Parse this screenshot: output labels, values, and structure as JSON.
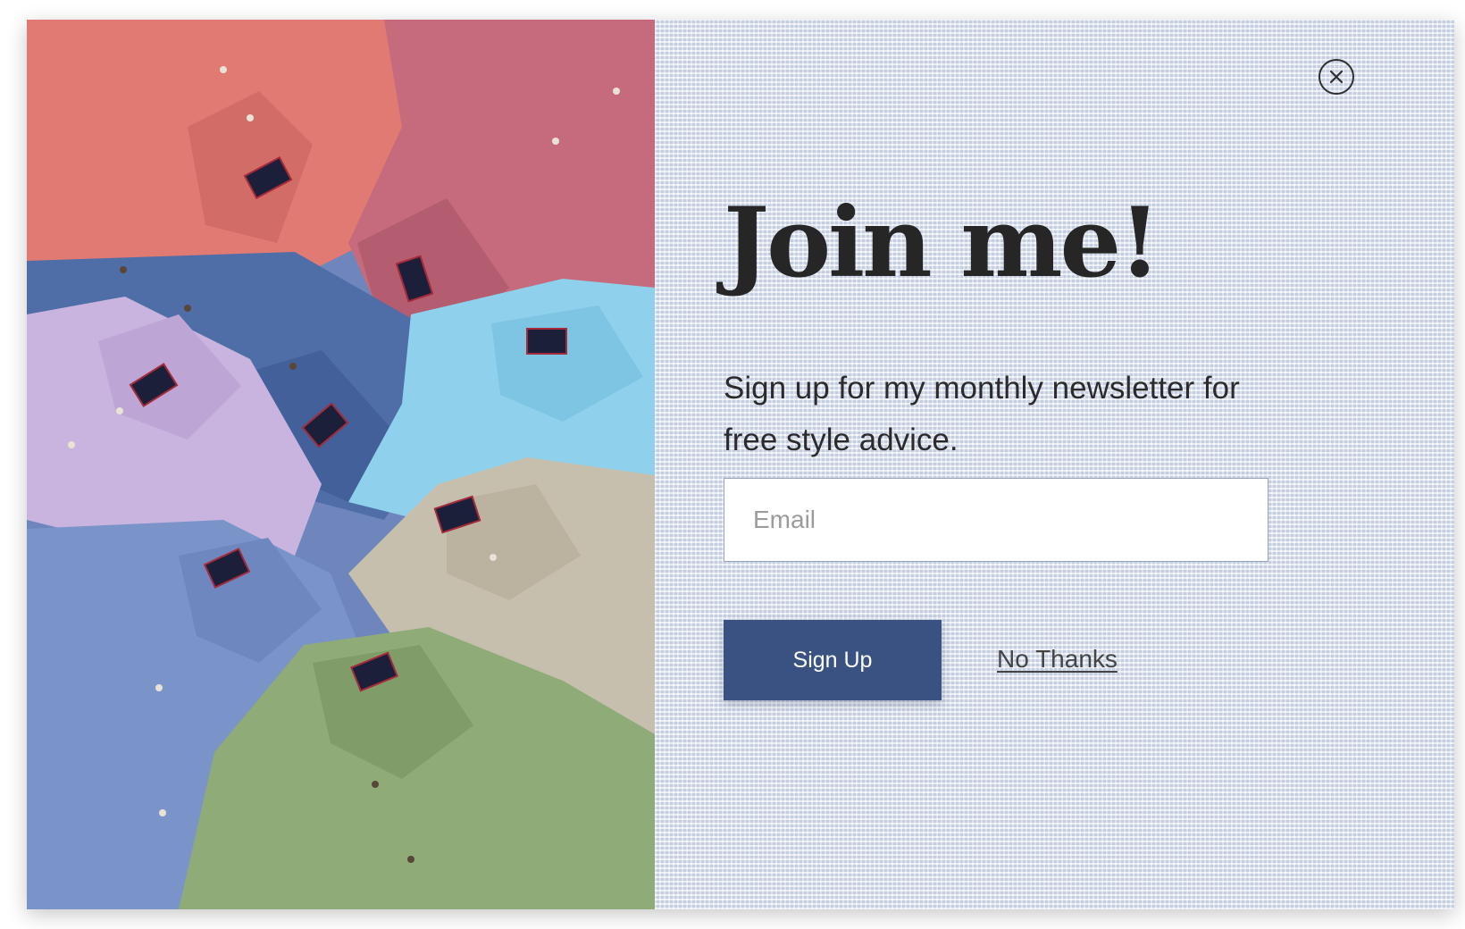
{
  "popup": {
    "headline": "Join me!",
    "subtext": "Sign up for my monthly newsletter for free style advice.",
    "email": {
      "placeholder": "Email",
      "value": ""
    },
    "signup_label": "Sign Up",
    "no_thanks_label": "No Thanks",
    "close_icon": "close-icon",
    "image_description_icon": "shirts-photo"
  },
  "colors": {
    "button": "#3a5282",
    "panel_background": "#dbe2ee",
    "headline": "#262626",
    "shirt_colors": [
      "#e07a72",
      "#c66a7e",
      "#5a7cb4",
      "#c9b4df",
      "#8fd1ec",
      "#c7bfae",
      "#7a94c9",
      "#8fab77"
    ]
  }
}
